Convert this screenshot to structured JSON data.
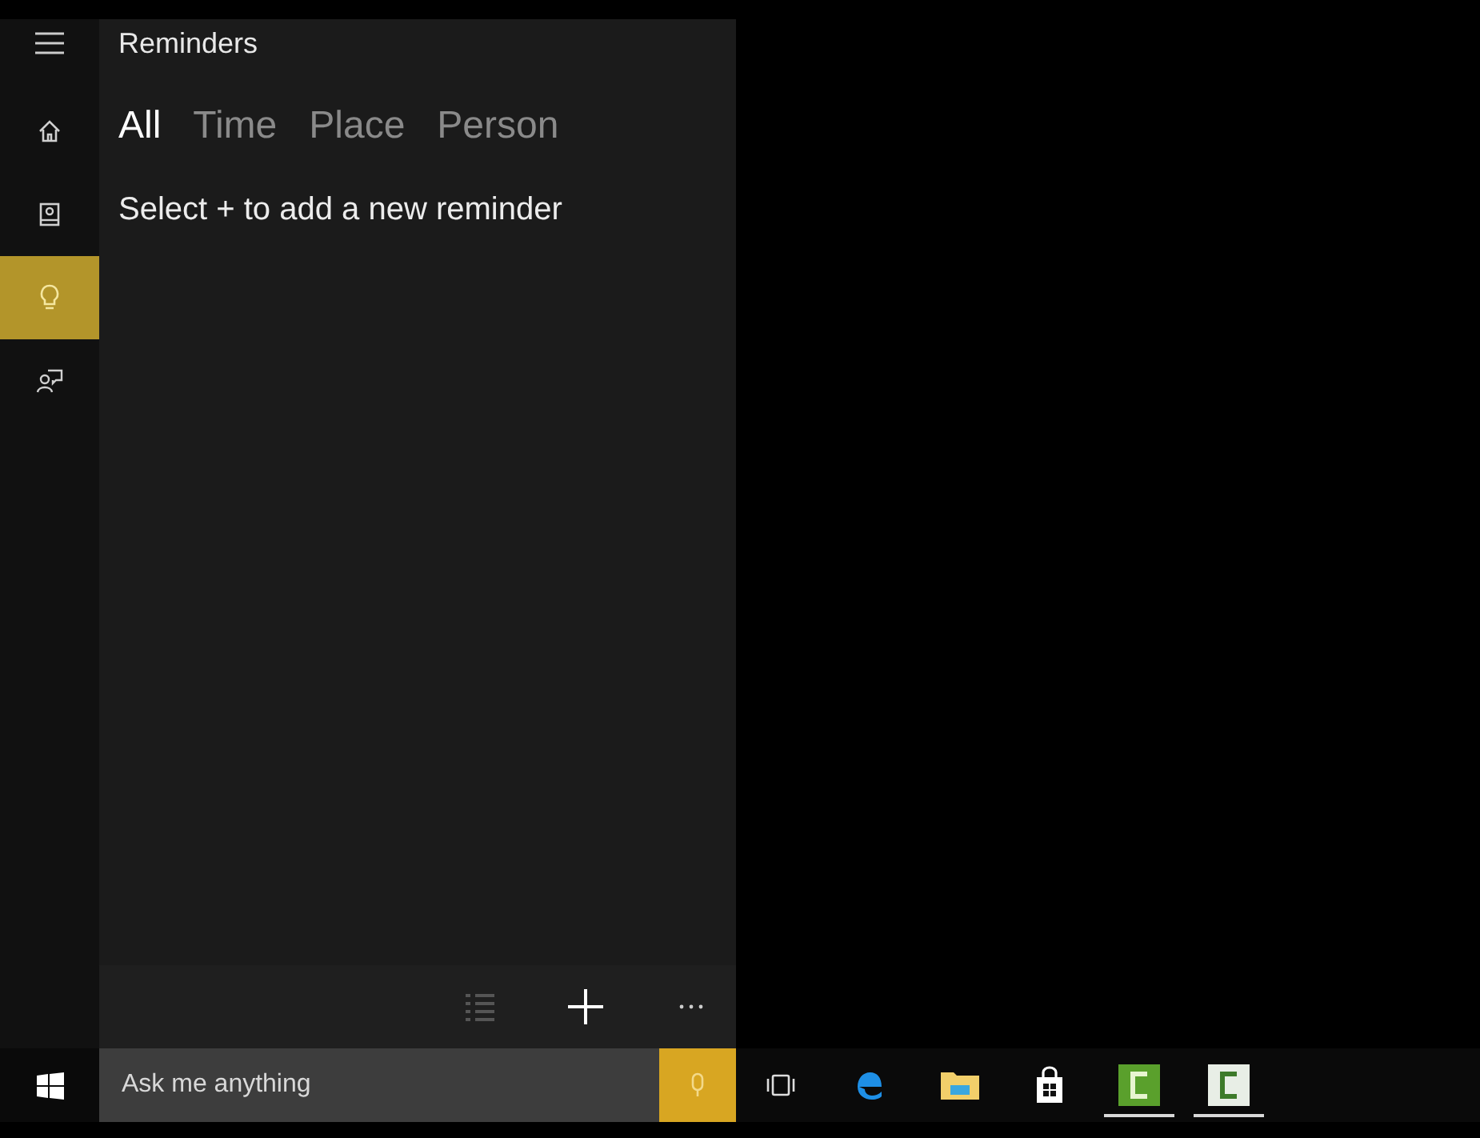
{
  "panel": {
    "title": "Reminders",
    "nav": [
      {
        "kind": "home",
        "selected": false
      },
      {
        "kind": "notebook",
        "selected": false
      },
      {
        "kind": "reminders",
        "selected": true
      },
      {
        "kind": "feedback",
        "selected": false
      }
    ],
    "tabs": [
      {
        "label": "All",
        "selected": true
      },
      {
        "label": "Time",
        "selected": false
      },
      {
        "label": "Place",
        "selected": false
      },
      {
        "label": "Person",
        "selected": false
      }
    ],
    "message": "Select + to add a new reminder"
  },
  "taskbar": {
    "search": {
      "placeholder": "Ask me anything"
    },
    "apps": [
      {
        "kind": "task-view",
        "running": false
      },
      {
        "kind": "browser",
        "running": false
      },
      {
        "kind": "folder",
        "running": false
      },
      {
        "kind": "store",
        "running": false
      },
      {
        "kind": "green-app",
        "running": true
      },
      {
        "kind": "white-app",
        "running": true
      }
    ]
  }
}
